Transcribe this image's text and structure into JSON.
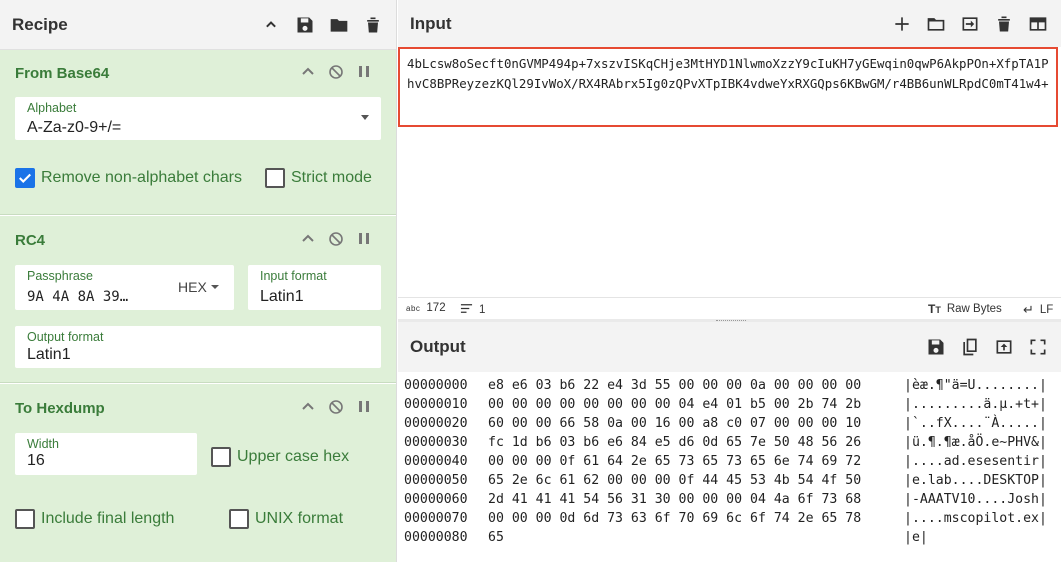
{
  "recipe": {
    "title": "Recipe",
    "operations": {
      "from_base64": {
        "title": "From Base64",
        "alphabet_label": "Alphabet",
        "alphabet_value": "A-Za-z0-9+/=",
        "remove_nonalpha_label": "Remove non-alphabet chars",
        "remove_nonalpha_checked": true,
        "strict_mode_label": "Strict mode",
        "strict_mode_checked": false
      },
      "rc4": {
        "title": "RC4",
        "passphrase_label": "Passphrase",
        "passphrase_value": "9A 4A 8A 39…",
        "passphrase_format": "HEX",
        "input_format_label": "Input format",
        "input_format_value": "Latin1",
        "output_format_label": "Output format",
        "output_format_value": "Latin1"
      },
      "to_hexdump": {
        "title": "To Hexdump",
        "width_label": "Width",
        "width_value": "16",
        "upper_case_label": "Upper case hex",
        "include_length_label": "Include final length",
        "unix_format_label": "UNIX format"
      }
    }
  },
  "input": {
    "title": "Input",
    "text": "4bLcsw8oSecft0nGVMP494p+7xszvISKqCHje3MtHYD1NlwmoXzzY9cIuKH7yGEwqin0qwP6AkpPOn+XfpTA1PhvC8BPReyzezKQl29IvWoX/RX4RAbrx5Ig0zQPvXTpIBK4vdweYxRXGQps6KBwGM/r4BB6unWLRpdC0mT41w4+",
    "char_count_icon": "abc",
    "char_count": "172",
    "line_count": "1",
    "encoding_label": "Raw Bytes",
    "eol_label": "LF"
  },
  "output": {
    "title": "Output",
    "rows": [
      {
        "addr": "00000000",
        "hex": "e8 e6 03 b6 22 e4 3d 55 00 00 00 0a 00 00 00 00",
        "ascii": "|èæ.¶\"ä=U........|"
      },
      {
        "addr": "00000010",
        "hex": "00 00 00 00 00 00 00 00 04 e4 01 b5 00 2b 74 2b",
        "ascii": "|.........ä.µ.+t+|"
      },
      {
        "addr": "00000020",
        "hex": "60 00 00 66 58 0a 00 16 00 a8 c0 07 00 00 00 10",
        "ascii": "|`..fX....¨À.....|"
      },
      {
        "addr": "00000030",
        "hex": "fc 1d b6 03 b6 e6 84 e5 d6 0d 65 7e 50 48 56 26",
        "ascii": "|ü.¶.¶æ.åÖ.e~PHV&|"
      },
      {
        "addr": "00000040",
        "hex": "00 00 00 0f 61 64 2e 65 73 65 73 65 6e 74 69 72",
        "ascii": "|....ad.esesentir|"
      },
      {
        "addr": "00000050",
        "hex": "65 2e 6c 61 62 00 00 00 0f 44 45 53 4b 54 4f 50",
        "ascii": "|e.lab....DESKTOP|"
      },
      {
        "addr": "00000060",
        "hex": "2d 41 41 41 54 56 31 30 00 00 00 04 4a 6f 73 68",
        "ascii": "|-AAATV10....Josh|"
      },
      {
        "addr": "00000070",
        "hex": "00 00 00 0d 6d 73 63 6f 70 69 6c 6f 74 2e 65 78",
        "ascii": "|....mscopilot.ex|"
      },
      {
        "addr": "00000080",
        "hex": "65",
        "ascii": "|e|"
      }
    ]
  },
  "colors": {
    "op_background": "#dff0d8",
    "op_text": "#3a7c3a",
    "input_highlight": "#e64a32",
    "checkbox_checked": "#1a73e8"
  }
}
